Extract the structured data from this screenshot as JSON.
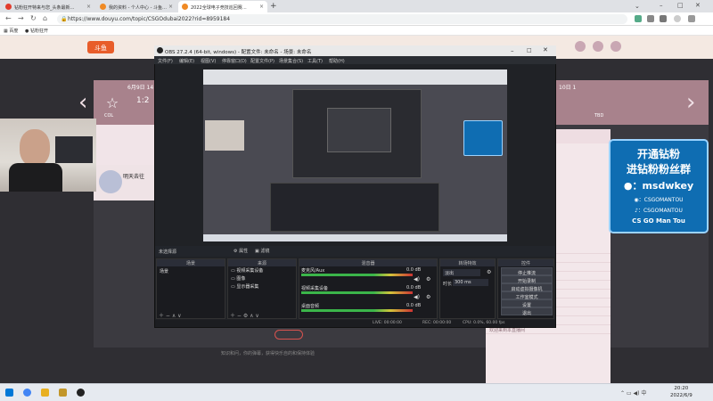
{
  "browser": {
    "tabs": [
      {
        "label": "钻粉狂开特来与您_头条最新…"
      },
      {
        "label": "我的资料 - 个人中心 - 斗鱼…"
      },
      {
        "label": "2022全球电子竞技巡回赛…"
      }
    ],
    "url": "https://www.douyu.com/topic/CSGOdubai2022?rid=8959184",
    "bookmarks": [
      "百度",
      "钻粉狂开"
    ]
  },
  "page": {
    "schedule_date": "6月9日 14",
    "score": "1:2",
    "team_left": "COL",
    "team_right": "TBD",
    "right_date": "10日 1",
    "left_bottom_label": "明天去往",
    "under_text": "知识和问，你的弹幕，获得快乐自的和保持体验"
  },
  "obs": {
    "title": "OBS 27.2.4 (64-bit, windows) - 配置文件: 未命名 - 场景: 未命名",
    "menu": [
      "文件(F)",
      "编辑(E)",
      "视图(V)",
      "停靠窗口(D)",
      "配置文件(P)",
      "场景集合(S)",
      "工具(T)",
      "帮助(H)"
    ],
    "no_source": "未选择源",
    "props_btn": "属性",
    "filter_btn": "滤镜",
    "headers": {
      "scenes": "场景",
      "sources": "来源",
      "mixer": "混音器",
      "transitions": "转场特效",
      "controls": "控件"
    },
    "scene_item": "场景",
    "sources": [
      "视频采集设备",
      "图像",
      "显示器采集"
    ],
    "mixer": [
      {
        "name": "麦克风/Aux",
        "db": "0.0 dB"
      },
      {
        "name": "视频采集设备",
        "db": "0.0 dB"
      },
      {
        "name": "桌面音频",
        "db": "0.0 dB"
      }
    ],
    "transition": "淡出",
    "duration_label": "时长",
    "duration_value": "300 ms",
    "controls": [
      "停止推流",
      "开始录制",
      "启动虚拟摄像机",
      "工作室模式",
      "设置",
      "退出"
    ],
    "status": {
      "live": "LIVE: 00:00:00",
      "rec": "REC: 00:00:00",
      "cpu": "CPU: 0.0%, 60.00 fps"
    }
  },
  "promo": {
    "line1": "开通钻粉",
    "line2": "进钻粉粉丝群",
    "wechat": "：msdwkey",
    "weibo": "：CSGOMANTOU",
    "douyin": "：CSGOMANTOU",
    "footer": "CS GO Man Tou"
  },
  "chat": {
    "lines": [
      "点击刷新弹幕",
      "欢迎来到本直播间",
      "欢迎来到本直播间",
      "欢迎来到本直播间",
      "欢迎来到本直播间",
      "欢迎来到本直播间",
      "欢迎来到本直播间",
      "欢迎来到本直播间",
      "欢迎来到本直播间",
      "欢迎来到本直播间"
    ]
  },
  "taskbar": {
    "time": "20:20",
    "date": "2022/6/9"
  },
  "colors": {
    "accent": "#0f6db2",
    "obs_bg": "#202226",
    "page_bg": "#2f2e33",
    "chat_bg": "#f3e7ea"
  }
}
